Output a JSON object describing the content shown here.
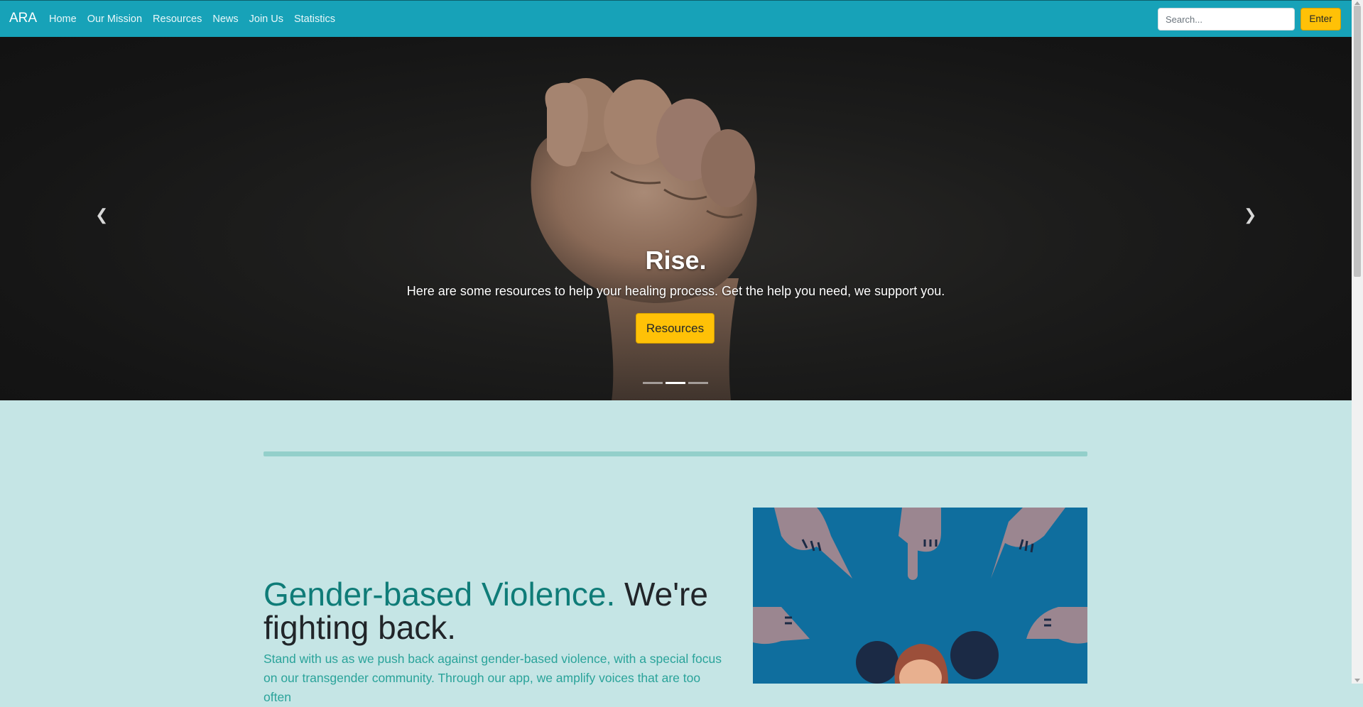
{
  "navbar": {
    "brand": "ARA",
    "links": [
      "Home",
      "Our Mission",
      "Resources",
      "News",
      "Join Us",
      "Statistics"
    ],
    "search_placeholder": "Search...",
    "enter_label": "Enter"
  },
  "hero": {
    "title": "Rise.",
    "text": "Here are some resources to help your healing process. Get the help you need, we support you.",
    "button_label": "Resources",
    "prev_icon": "chevron-left-icon",
    "next_icon": "chevron-right-icon",
    "slides_count": 3,
    "active_slide": 2
  },
  "section": {
    "headline_accent": "Gender-based Violence.",
    "headline_rest": "We're fighting back.",
    "lead": "Stand with us as we push back against gender-based violence, with a special focus on our transgender community. Through our app, we amplify voices that are too often"
  },
  "colors": {
    "navbar": "#17a2b8",
    "accent_button": "#ffc107",
    "page_background": "#c5e5e5",
    "headline_accent": "#0f7c78",
    "illustration_background": "#0f6e9e"
  }
}
